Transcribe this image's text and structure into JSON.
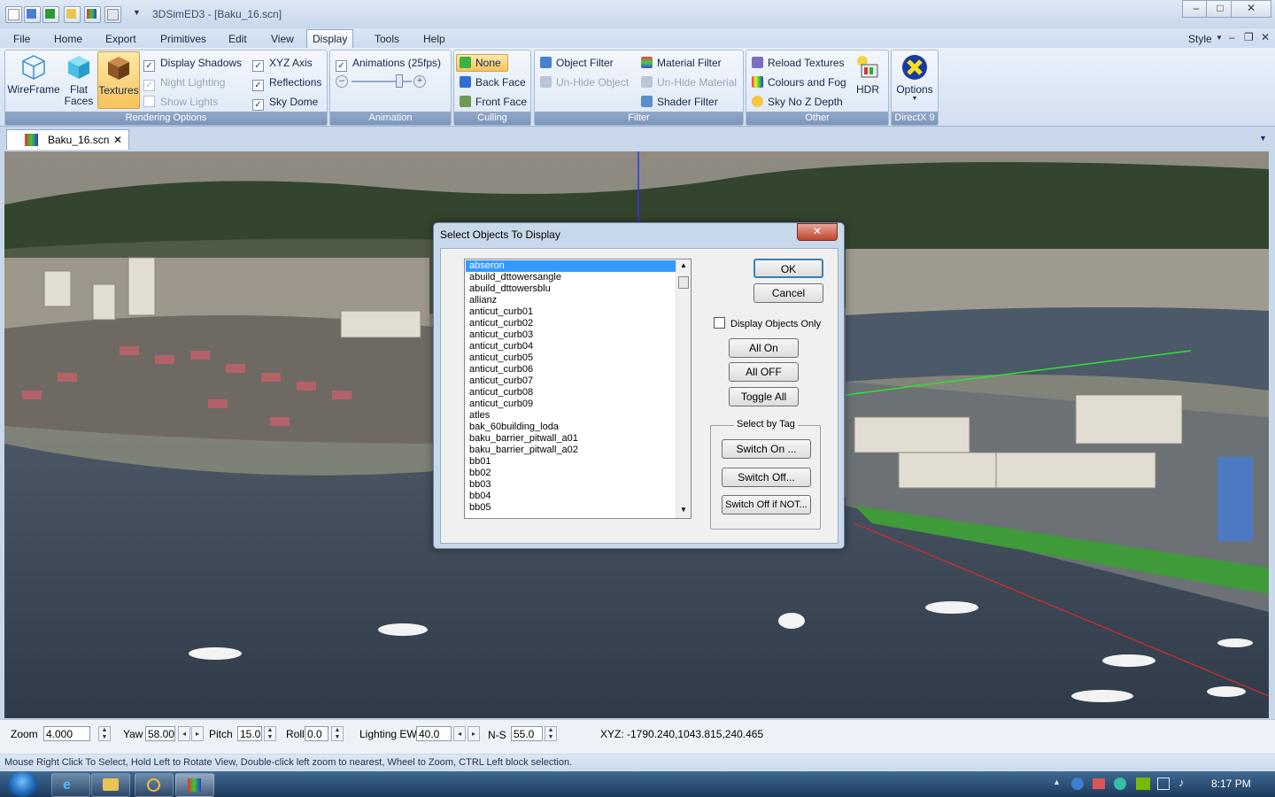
{
  "window": {
    "title": "3DSimED3 - [Baku_16.scn]",
    "controls": {
      "minimize": "–",
      "maximize": "□",
      "close": "✕"
    }
  },
  "menu": {
    "items": [
      "File",
      "Home",
      "Export",
      "Primitives",
      "Edit",
      "View",
      "Display",
      "Tools",
      "Help"
    ],
    "active": "Display",
    "style_label": "Style",
    "mdi_controls": [
      "–",
      "❐",
      "✕"
    ]
  },
  "ribbon": {
    "rendering": {
      "title": "Rendering Options",
      "big_buttons": [
        "WireFrame",
        "Flat Faces",
        "Textures"
      ],
      "display_shadows": "Display Shadows",
      "night_lighting": "Night Lighting",
      "show_lights": "Show Lights",
      "xyz_axis": "XYZ Axis",
      "reflections": "Reflections",
      "sky_dome": "Sky Dome"
    },
    "animation": {
      "title": "Animation",
      "animations": "Animations (25fps)",
      "slider_level": 0.78
    },
    "culling": {
      "title": "Culling",
      "none": "None",
      "back_face": "Back Face",
      "front_face": "Front Face"
    },
    "filter": {
      "title": "Filter",
      "object_filter": "Object Filter",
      "unhide_object": "Un-Hide Object",
      "material_filter": "Material Filter",
      "unhide_material": "Un-Hide Material",
      "shader_filter": "Shader Filter"
    },
    "other": {
      "title": "Other",
      "reload_textures": "Reload Textures",
      "colours_fog": "Colours and Fog",
      "sky_no_z": "Sky No Z Depth",
      "hdr": "HDR"
    },
    "directx": {
      "title": "DirectX 9",
      "options": "Options"
    }
  },
  "doc_tab": {
    "label": "Baku_16.scn",
    "close": "✕"
  },
  "dialog": {
    "title": "Select Objects To Display",
    "close": "✕",
    "items": [
      "abseron",
      "abuild_dttowersangle",
      "abuild_dttowersblu",
      "allianz",
      "anticut_curb01",
      "anticut_curb02",
      "anticut_curb03",
      "anticut_curb04",
      "anticut_curb05",
      "anticut_curb06",
      "anticut_curb07",
      "anticut_curb08",
      "anticut_curb09",
      "atles",
      "bak_60building_loda",
      "baku_barrier_pitwall_a01",
      "baku_barrier_pitwall_a02",
      "bb01",
      "bb02",
      "bb03",
      "bb04",
      "bb05"
    ],
    "selected": "abseron",
    "ok": "OK",
    "cancel": "Cancel",
    "display_objects_only": "Display Objects Only",
    "all_on": "All On",
    "all_off": "All OFF",
    "toggle_all": "Toggle All",
    "select_by_tag": "Select by Tag",
    "switch_on": "Switch On ...",
    "switch_off": "Switch Off...",
    "switch_off_if_not": "Switch Off if NOT..."
  },
  "bottom": {
    "zoom_label": "Zoom",
    "zoom_value": "4.000",
    "yaw_label": "Yaw",
    "yaw_value": "58.00(",
    "pitch_label": "Pitch",
    "pitch_value": "15.0",
    "roll_label": "Roll",
    "roll_value": "0.0",
    "lighting_label": "Lighting EW",
    "lighting_value": "40.0",
    "ns_label": "N-S",
    "ns_value": "55.0",
    "xyz": "XYZ: -1790.240,1043.815,240.465"
  },
  "status": "Mouse Right Click To Select, Hold Left to Rotate View, Double-click left  zoom to nearest, Wheel to Zoom, CTRL Left block selection.",
  "taskbar": {
    "time": "8:17 PM"
  },
  "colors": {
    "accent": "#3399ff",
    "ribbon_group_title": "#7d95ba",
    "water": "#3a4756"
  }
}
